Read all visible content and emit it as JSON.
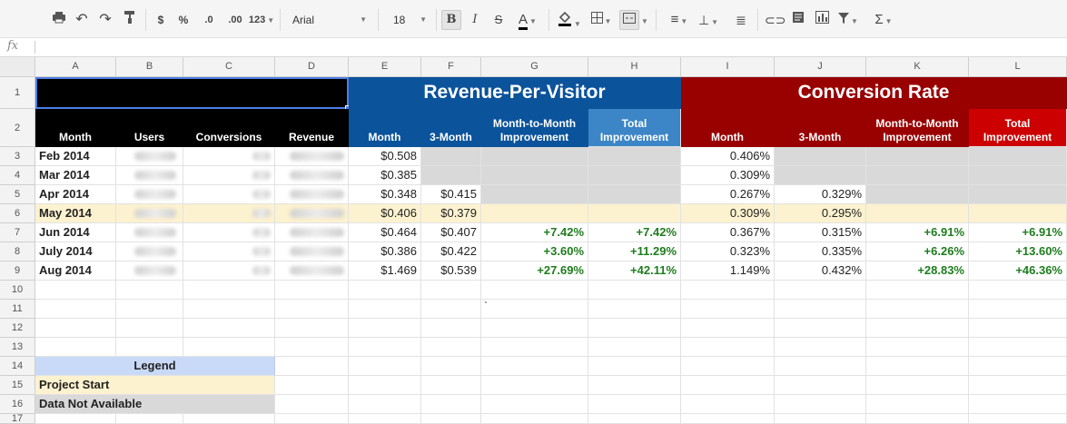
{
  "toolbar": {
    "currency": "$",
    "percent": "%",
    "dec_decrease": ".0",
    "dec_increase": ".00",
    "more_formats": "123",
    "font": "Arial",
    "font_size": "18",
    "bold": "B",
    "italic": "I",
    "strike": "S",
    "text_color": "A",
    "sum": "Σ"
  },
  "formula_bar": {
    "fx": "fx",
    "value": ""
  },
  "columns": [
    "A",
    "B",
    "C",
    "D",
    "E",
    "F",
    "G",
    "H",
    "I",
    "J",
    "K",
    "L"
  ],
  "rows": [
    "1",
    "2",
    "3",
    "4",
    "5",
    "6",
    "7",
    "8",
    "9",
    "10",
    "11",
    "12",
    "13",
    "14",
    "15",
    "16",
    "17"
  ],
  "headers": {
    "rpv_title": "Revenue-Per-Visitor",
    "cr_title": "Conversion Rate",
    "month": "Month",
    "users": "Users",
    "conversions": "Conversions",
    "revenue": "Revenue",
    "rpv_month": "Month",
    "rpv_3month": "3-Month",
    "rpv_mtm": "Month-to-Month Improvement",
    "rpv_total": "Total Improvement",
    "cr_month": "Month",
    "cr_3month": "3-Month",
    "cr_mtm": "Month-to-Month Improvement",
    "cr_total": "Total Improvement"
  },
  "data_rows": [
    {
      "month": "Feb 2014",
      "rpv": "$0.508",
      "rpv3": "",
      "rpv_mtm": "",
      "rpv_total": "",
      "cr": "0.406%",
      "cr3": "",
      "cr_mtm": "",
      "cr_total": ""
    },
    {
      "month": "Mar 2014",
      "rpv": "$0.385",
      "rpv3": "",
      "rpv_mtm": "",
      "rpv_total": "",
      "cr": "0.309%",
      "cr3": "",
      "cr_mtm": "",
      "cr_total": ""
    },
    {
      "month": "Apr 2014",
      "rpv": "$0.348",
      "rpv3": "$0.415",
      "rpv_mtm": "",
      "rpv_total": "",
      "cr": "0.267%",
      "cr3": "0.329%",
      "cr_mtm": "",
      "cr_total": ""
    },
    {
      "month": "May 2014",
      "rpv": "$0.406",
      "rpv3": "$0.379",
      "rpv_mtm": "",
      "rpv_total": "",
      "cr": "0.309%",
      "cr3": "0.295%",
      "cr_mtm": "",
      "cr_total": ""
    },
    {
      "month": "Jun 2014",
      "rpv": "$0.464",
      "rpv3": "$0.407",
      "rpv_mtm": "+7.42%",
      "rpv_total": "+7.42%",
      "cr": "0.367%",
      "cr3": "0.315%",
      "cr_mtm": "+6.91%",
      "cr_total": "+6.91%"
    },
    {
      "month": "July 2014",
      "rpv": "$0.386",
      "rpv3": "$0.422",
      "rpv_mtm": "+3.60%",
      "rpv_total": "+11.29%",
      "cr": "0.323%",
      "cr3": "0.335%",
      "cr_mtm": "+6.26%",
      "cr_total": "+13.60%"
    },
    {
      "month": "Aug 2014",
      "rpv": "$1.469",
      "rpv3": "$0.539",
      "rpv_mtm": "+27.69%",
      "rpv_total": "+42.11%",
      "cr": "1.149%",
      "cr3": "0.432%",
      "cr_mtm": "+28.83%",
      "cr_total": "+46.36%"
    }
  ],
  "stray_mark": "`",
  "legend": {
    "title": "Legend",
    "project_start": "Project Start",
    "not_available": "Data Not Available"
  },
  "colors": {
    "black_header": "#000000",
    "rpv_header": "#0b539b",
    "rpv_header_light": "#3c85c6",
    "cr_header": "#990000",
    "cr_header_light": "#cc0000",
    "project_start": "#fdf2cf",
    "not_available": "#d9d9d9",
    "positive": "#1e7d1e"
  }
}
